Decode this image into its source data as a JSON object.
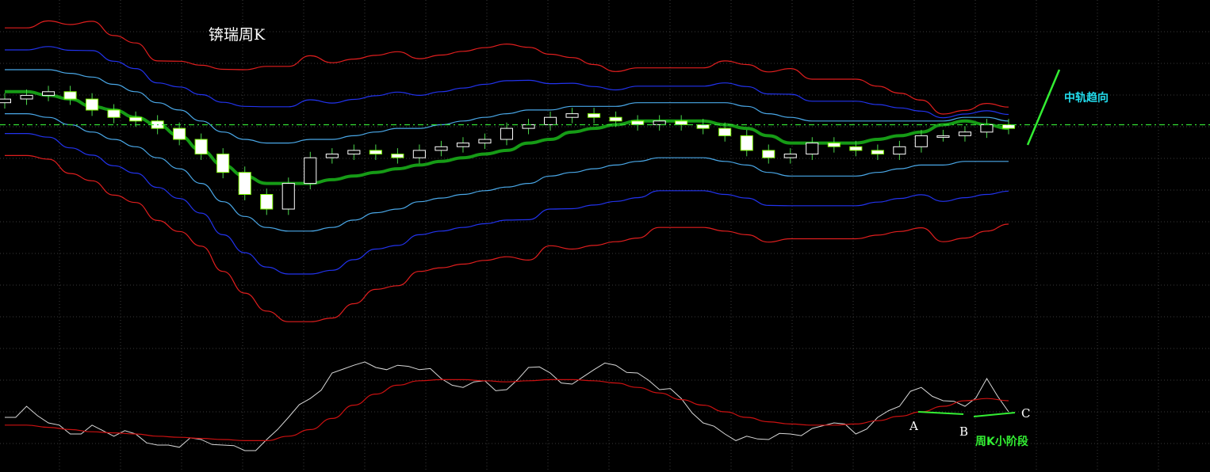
{
  "annotations": {
    "title": "锛瑞周K",
    "middle_trend": "中轨趋向",
    "points": [
      "A",
      "B",
      "C"
    ],
    "stage_label": "周K小阶段"
  },
  "colors": {
    "background": "#000000",
    "grid": "#3a3a3a",
    "candle_up": "#ffffff",
    "candle_body_down": "#7CFC00",
    "candle_wick": "#4cd64c",
    "middle_band": "#169b16",
    "inner_band": "#4aa8e8",
    "mid_band": "#2233ee",
    "outer_band": "#e01e1e",
    "reference_line": "#33dd33",
    "oscillator": "#d8d8d8",
    "oscillator_signal": "#cc1111",
    "annotation_cyan": "#22ddee",
    "annotation_green": "#33ee33"
  },
  "chart_data": [
    {
      "type": "candlestick",
      "panel": "price",
      "title": "锛瑞周K",
      "grid": true,
      "series": [
        {
          "name": "",
          "kind": "middle_band",
          "values": [
            80,
            80,
            79,
            78,
            76,
            75,
            73,
            71,
            68,
            64,
            60,
            57,
            55,
            55,
            55,
            56,
            57,
            58,
            59,
            60,
            61,
            62,
            63,
            64,
            66,
            67,
            69,
            70,
            71,
            72,
            72,
            72,
            72,
            71,
            70,
            68,
            66,
            66,
            66,
            66,
            67,
            68,
            69,
            71,
            72,
            71,
            70
          ]
        },
        {
          "name": "",
          "kind": "inner_band_upper",
          "values": [
            86,
            86,
            86,
            85,
            84,
            82,
            80,
            77,
            75,
            72,
            69,
            67,
            66,
            66,
            67,
            67,
            68,
            69,
            70,
            70,
            71,
            72,
            73,
            74,
            75,
            75,
            76,
            76,
            76,
            77,
            77,
            77,
            77,
            77,
            76,
            74,
            73,
            72,
            72,
            72,
            72,
            72,
            72,
            72,
            73,
            73,
            72
          ]
        },
        {
          "name": "",
          "kind": "inner_band_lower",
          "values": [
            74,
            74,
            73,
            71,
            69,
            67,
            65,
            62,
            59,
            55,
            50,
            46,
            43,
            42,
            42,
            43,
            45,
            47,
            48,
            50,
            51,
            52,
            53,
            54,
            55,
            57,
            58,
            59,
            60,
            61,
            62,
            62,
            62,
            61,
            60,
            58,
            57,
            57,
            57,
            57,
            58,
            59,
            60,
            60,
            61,
            61,
            61
          ]
        }
      ],
      "candles_close": [
        78,
        79,
        80,
        78,
        75,
        73,
        72,
        70,
        67,
        63,
        58,
        52,
        48,
        55,
        62,
        63,
        64,
        63,
        62,
        64,
        65,
        66,
        67,
        70,
        71,
        73,
        74,
        73,
        72,
        71,
        72,
        71,
        70,
        68,
        64,
        62,
        63,
        66,
        65,
        64,
        63,
        65,
        68,
        68,
        69,
        71,
        70
      ]
    },
    {
      "type": "line",
      "panel": "oscillator",
      "grid": true,
      "series": [
        {
          "name": "",
          "kind": "oscillator",
          "values": [
            45,
            55,
            40,
            30,
            38,
            28,
            30,
            20,
            18,
            25,
            20,
            15,
            25,
            45,
            62,
            85,
            92,
            90,
            92,
            88,
            80,
            72,
            78,
            70,
            90,
            85,
            75,
            88,
            92,
            85,
            70,
            62,
            40,
            30,
            28,
            25,
            30,
            35,
            40,
            30,
            45,
            55,
            72,
            60,
            55,
            80,
            50
          ]
        },
        {
          "name": "",
          "kind": "signal",
          "values": [
            38,
            38,
            36,
            34,
            32,
            31,
            30,
            28,
            27,
            26,
            25,
            24,
            24,
            28,
            34,
            44,
            56,
            66,
            74,
            78,
            79,
            79,
            78,
            77,
            78,
            79,
            79,
            78,
            76,
            72,
            67,
            61,
            56,
            50,
            45,
            41,
            39,
            38,
            38,
            39,
            42,
            46,
            50,
            55,
            60,
            62,
            60
          ]
        }
      ]
    }
  ]
}
